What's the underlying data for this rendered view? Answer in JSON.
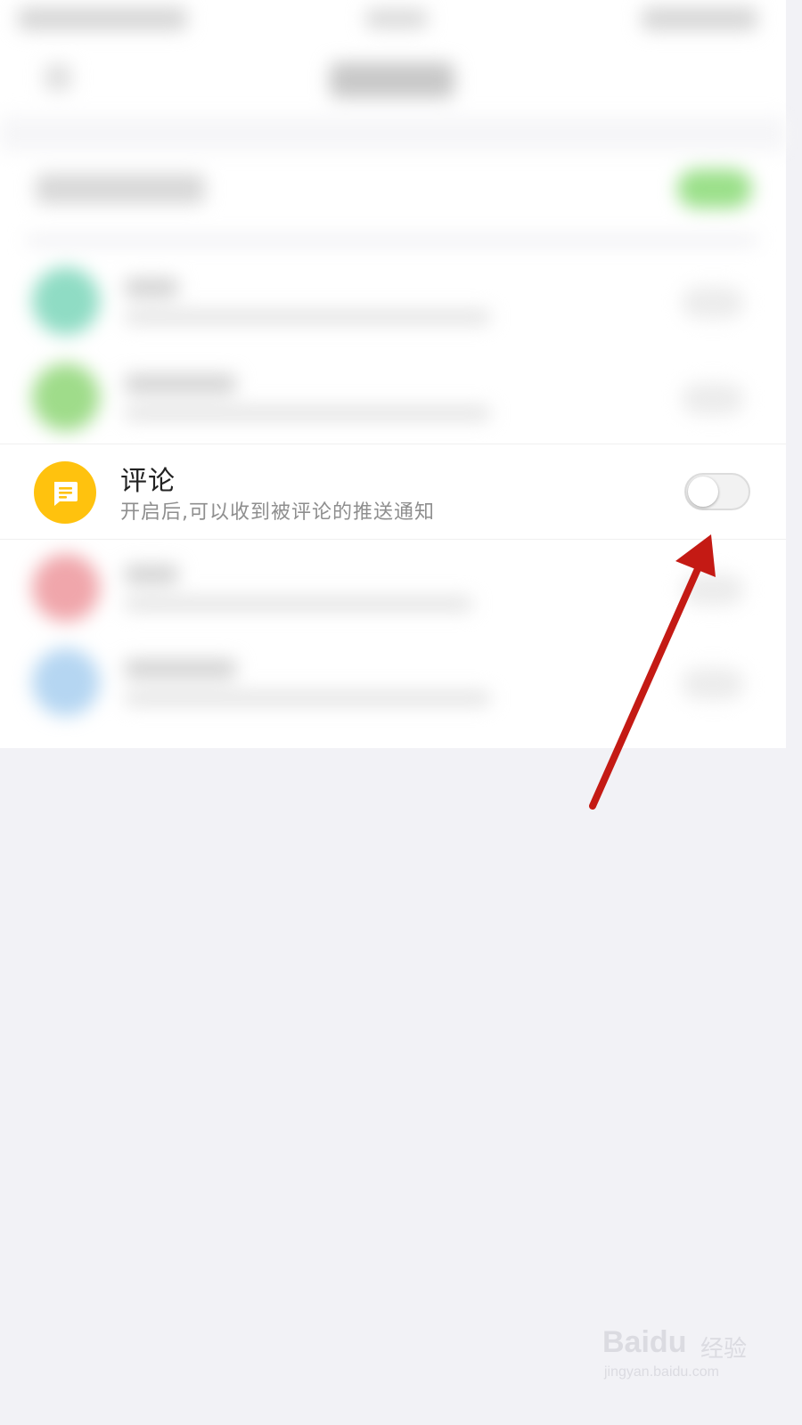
{
  "comment_row": {
    "title": "评论",
    "subtitle": "开启后,可以收到被评论的推送通知",
    "enabled": false,
    "icon": "comment-bubble-icon",
    "icon_color": "#ffc20e"
  },
  "blurred_rows": [
    {
      "bubble_color": "#8fdcc4",
      "title_len": "short"
    },
    {
      "bubble_color": "#9fdc8a",
      "title_len": "long"
    },
    {
      "bubble_color": "#f0a6ab",
      "title_len": "short"
    },
    {
      "bubble_color": "#b5d6f2",
      "title_len": "long"
    }
  ],
  "annotation": {
    "arrow_color": "#c41a14"
  },
  "watermark": {
    "brand": "Bai",
    "brand_suffix": "du",
    "label": "经验",
    "url": "jingyan.baidu.com"
  }
}
